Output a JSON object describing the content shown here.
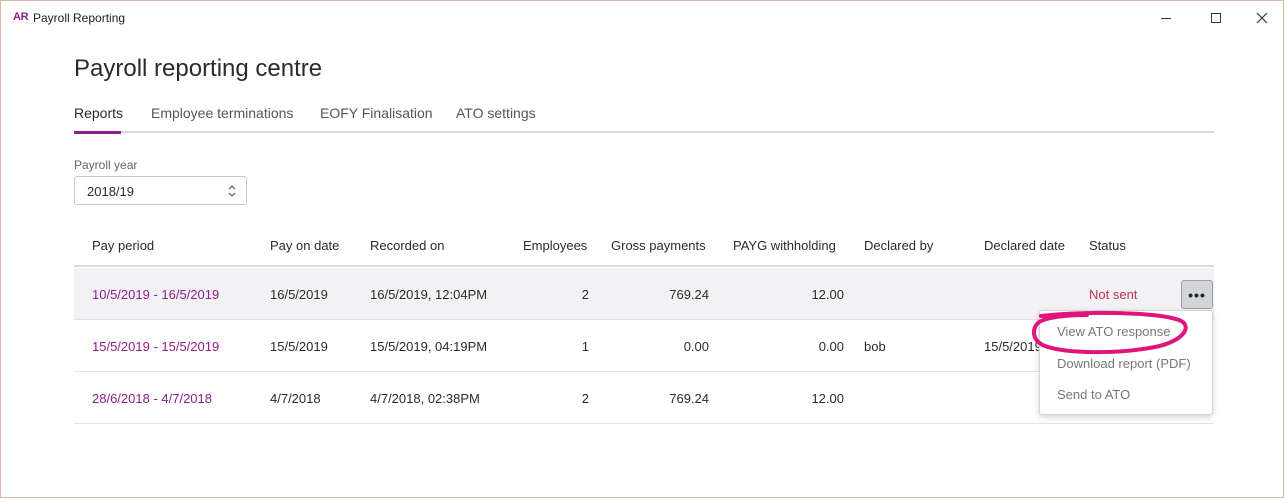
{
  "window": {
    "logo": "AR",
    "title": "Payroll Reporting",
    "controls": {
      "minimize": "minimize-icon",
      "maximize": "maximize-icon",
      "close": "close-icon"
    }
  },
  "page": {
    "title": "Payroll reporting centre"
  },
  "tabs": [
    {
      "label": "Reports",
      "active": true
    },
    {
      "label": "Employee terminations",
      "active": false
    },
    {
      "label": "EOFY Finalisation",
      "active": false
    },
    {
      "label": "ATO settings",
      "active": false
    }
  ],
  "filter": {
    "label": "Payroll year",
    "value": "2018/19"
  },
  "table": {
    "headers": [
      "Pay period",
      "Pay on date",
      "Recorded on",
      "Employees",
      "Gross payments",
      "PAYG withholding",
      "Declared by",
      "Declared date",
      "Status"
    ],
    "rows": [
      {
        "pay_period": "10/5/2019 - 16/5/2019",
        "pay_on_date": "16/5/2019",
        "recorded_on": "16/5/2019, 12:04PM",
        "employees": "2",
        "gross": "769.24",
        "payg": "12.00",
        "declared_by": "",
        "declared_date": "",
        "status": "Not sent"
      },
      {
        "pay_period": "15/5/2019 - 15/5/2019",
        "pay_on_date": "15/5/2019",
        "recorded_on": "15/5/2019, 04:19PM",
        "employees": "1",
        "gross": "0.00",
        "payg": "0.00",
        "declared_by": "bob",
        "declared_date": "15/5/2019",
        "status": ""
      },
      {
        "pay_period": "28/6/2018 - 4/7/2018",
        "pay_on_date": "4/7/2018",
        "recorded_on": "4/7/2018, 02:38PM",
        "employees": "2",
        "gross": "769.24",
        "payg": "12.00",
        "declared_by": "",
        "declared_date": "",
        "status": ""
      }
    ]
  },
  "row_menu": {
    "button_icon": "more-options-icon",
    "items": [
      "View ATO response",
      "Download report (PDF)",
      "Send to ATO"
    ]
  },
  "colors": {
    "accent": "#8e1f8b",
    "status_not_sent": "#c22d55",
    "highlight_ring": "#e0147a"
  }
}
